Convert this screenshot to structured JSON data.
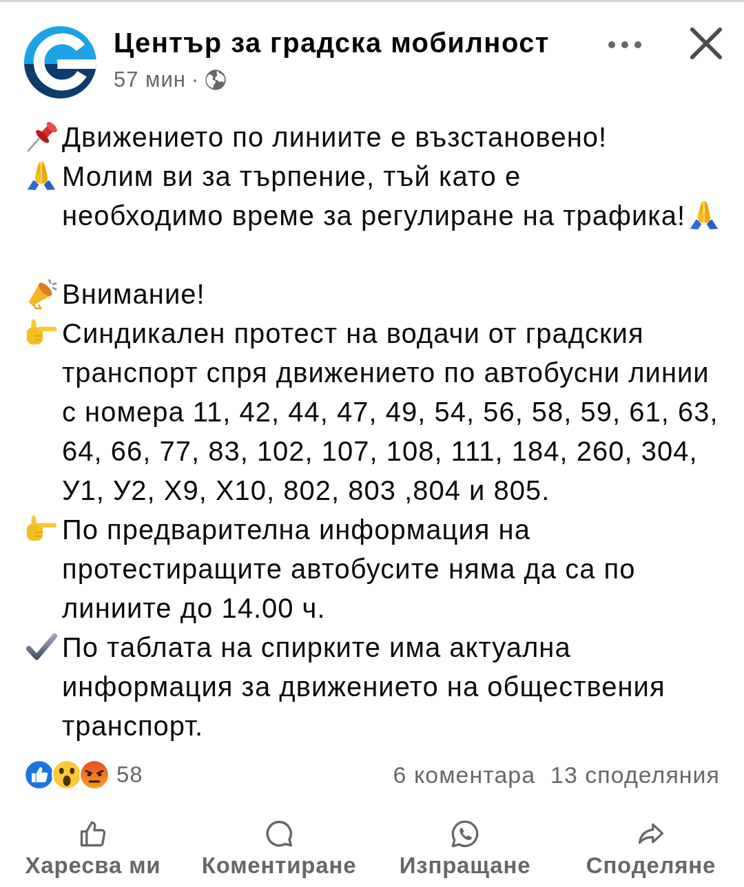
{
  "post": {
    "page_name": "Център за градска мобилност",
    "time": "57 мин",
    "separator": "·",
    "paragraphs": [
      {
        "items": [
          {
            "kind": "pin",
            "lines": [
              "Движението по линиите е възстановено!"
            ]
          },
          {
            "kind": "pray",
            "lines": [
              "Молим ви за търпение, тъй като е",
              "необходимо време за регулиране на трафика!"
            ]
          }
        ]
      },
      {
        "items": [
          {
            "kind": "megaphone",
            "lines": [
              "Внимание!"
            ]
          },
          {
            "kind": "point",
            "lines": [
              "Синдикален протест на водачи от градския транспорт спря движението по автобусни линии с номера 11, 42, 44, 47, 49, 54, 56, 58, 59, 61, 63, 64, 66, 77, 83, 102, 107, 108, 111, 184, 260, 304, У1, У2, Х9, Х10, 802, 803 ,804 и 805."
            ]
          },
          {
            "kind": "point",
            "lines": [
              "По предварителна информация на протестиращите автобусите няма да са по линиите до 14.00 ч."
            ]
          },
          {
            "kind": "check",
            "lines": [
              "По таблата на спирките има актуална информация за движението на обществения транспорт."
            ]
          }
        ]
      }
    ]
  },
  "reactions": {
    "icons": [
      {
        "kind": "like"
      },
      {
        "kind": "wow"
      },
      {
        "kind": "angry"
      }
    ],
    "count": "58",
    "comments": "6 коментара",
    "shares": "13 споделяния"
  },
  "actions": [
    {
      "kind": "like",
      "label": "Харесва ми"
    },
    {
      "kind": "comment",
      "label": "Коментиране"
    },
    {
      "kind": "send",
      "label": "Изпращане"
    },
    {
      "kind": "share",
      "label": "Споделяне"
    }
  ]
}
